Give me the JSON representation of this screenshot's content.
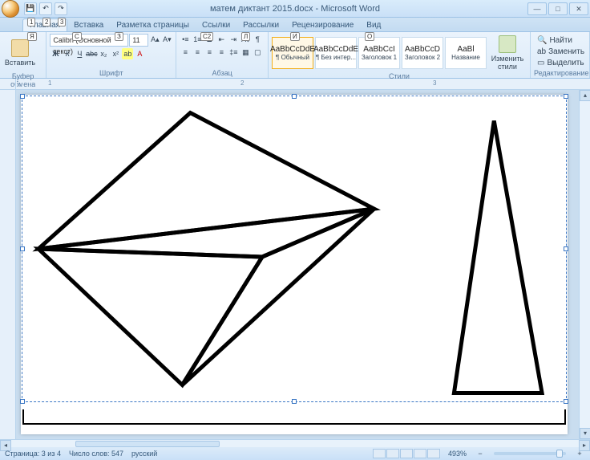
{
  "title": "матем диктант 2015.docx - Microsoft Word",
  "qat_tips": [
    "1",
    "2",
    "3"
  ],
  "tabs": [
    {
      "label": "Главная",
      "tip": "Я",
      "active": true
    },
    {
      "label": "Вставка",
      "tip": "С"
    },
    {
      "label": "Разметка страницы",
      "tip": "З"
    },
    {
      "label": "Ссылки",
      "tip": "С2"
    },
    {
      "label": "Рассылки",
      "tip": "Л"
    },
    {
      "label": "Рецензирование",
      "tip": "И"
    },
    {
      "label": "Вид",
      "tip": "О"
    }
  ],
  "ribbon": {
    "clipboard": {
      "label": "Буфер обмена",
      "paste": "Вставить"
    },
    "font": {
      "label": "Шрифт",
      "name": "Calibri (Основной текст)",
      "size": "11",
      "bold": "Ж",
      "italic": "К",
      "underline": "Ч"
    },
    "paragraph": {
      "label": "Абзац"
    },
    "styles": {
      "label": "Стили",
      "items": [
        {
          "preview": "AaBbCcDdE",
          "name": "¶ Обычный",
          "sel": true
        },
        {
          "preview": "AaBbCcDdE",
          "name": "¶ Без интер..."
        },
        {
          "preview": "AaBbCcI",
          "name": "Заголовок 1"
        },
        {
          "preview": "AaBbCcD",
          "name": "Заголовок 2"
        },
        {
          "preview": "AaBl",
          "name": "Название"
        }
      ],
      "change": "Изменить стили"
    },
    "editing": {
      "label": "Редактирование",
      "find": "Найти",
      "replace": "Заменить",
      "select": "Выделить"
    }
  },
  "ruler_marks": [
    "1",
    "2",
    "3"
  ],
  "status": {
    "page": "Страница: 3 из 4",
    "words": "Число слов: 547",
    "lang": "русский",
    "zoom": "493%"
  }
}
